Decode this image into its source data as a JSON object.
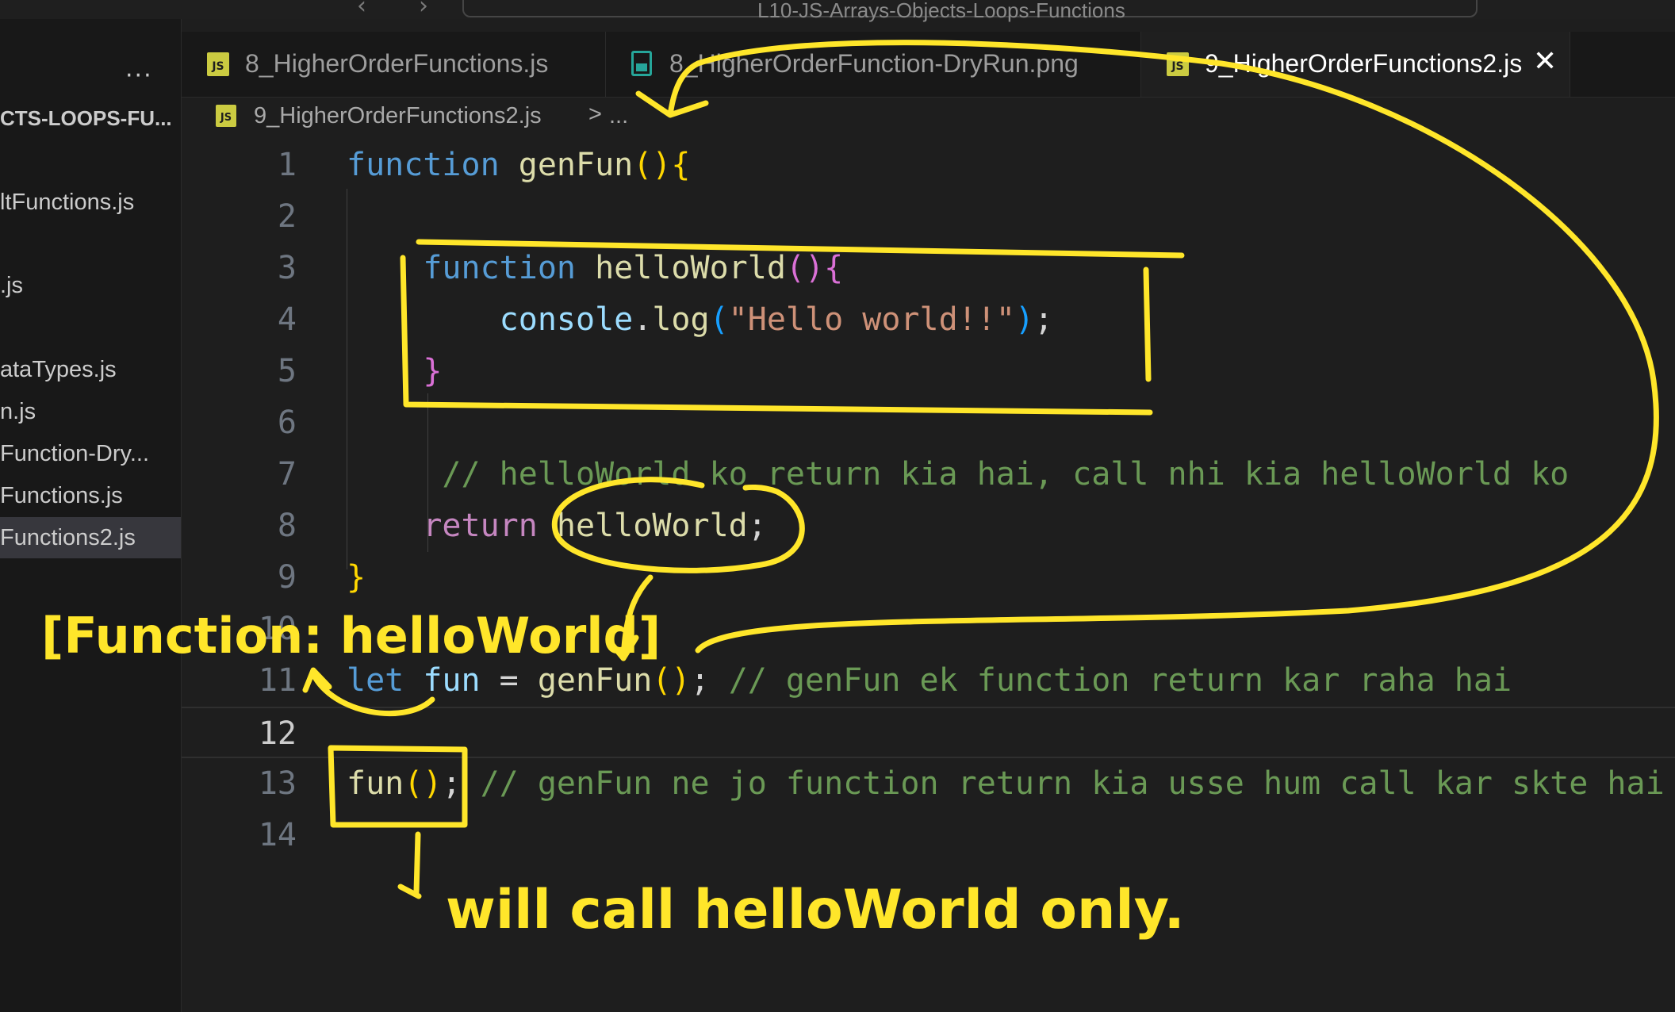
{
  "titlebar": {
    "search_text": "L10-JS-Arrays-Objects-Loops-Functions",
    "back_glyph": "‹",
    "forward_glyph": "›"
  },
  "sidebar": {
    "more": "···",
    "folder_title": "CTS-LOOPS-FU...",
    "items": [
      {
        "label": "ltFunctions.js"
      },
      {
        "label": ".js"
      },
      {
        "label": "ataTypes.js"
      },
      {
        "label": "n.js"
      },
      {
        "label": "Function-Dry..."
      },
      {
        "label": "Functions.js"
      },
      {
        "label": "Functions2.js",
        "active": true
      }
    ]
  },
  "tabs": [
    {
      "label": "8_HigherOrderFunctions.js",
      "icon": "js-file-icon",
      "active": false
    },
    {
      "label": "8_HigherOrderFunction-DryRun.png",
      "icon": "image-file-icon",
      "active": false
    },
    {
      "label": "9_HigherOrderFunctions2.js",
      "icon": "js-file-icon",
      "active": true,
      "close": "✕"
    }
  ],
  "breadcrumb": {
    "icon_text": "JS",
    "file": "9_HigherOrderFunctions2.js",
    "separator": ">",
    "symbol": "..."
  },
  "editor": {
    "current_line": 12,
    "line_numbers": [
      "1",
      "2",
      "3",
      "4",
      "5",
      "6",
      "7",
      "8",
      "9",
      "10",
      "11",
      "12",
      "13",
      "14"
    ],
    "lines": [
      "function genFun(){",
      "",
      "    function helloWorld(){",
      "        console.log(\"Hello world!!\");",
      "    }",
      "",
      "     // helloWorld ko return kia hai, call nhi kia helloWorld ko",
      "    return helloWorld;",
      "}",
      "",
      "let fun = genFun(); // genFun ek function return kar raha hai",
      "",
      "fun(); // genFun ne jo function return kia usse hum call kar skte hai",
      ""
    ]
  },
  "annotations": {
    "function_label": "[Function: helloWorld]",
    "call_note": "will call helloWorld only."
  },
  "colors": {
    "annotation": "#ffe62a",
    "background": "#1e1e1e",
    "keyword": "#569cd6",
    "comment": "#6a9955",
    "string": "#ce9178"
  }
}
